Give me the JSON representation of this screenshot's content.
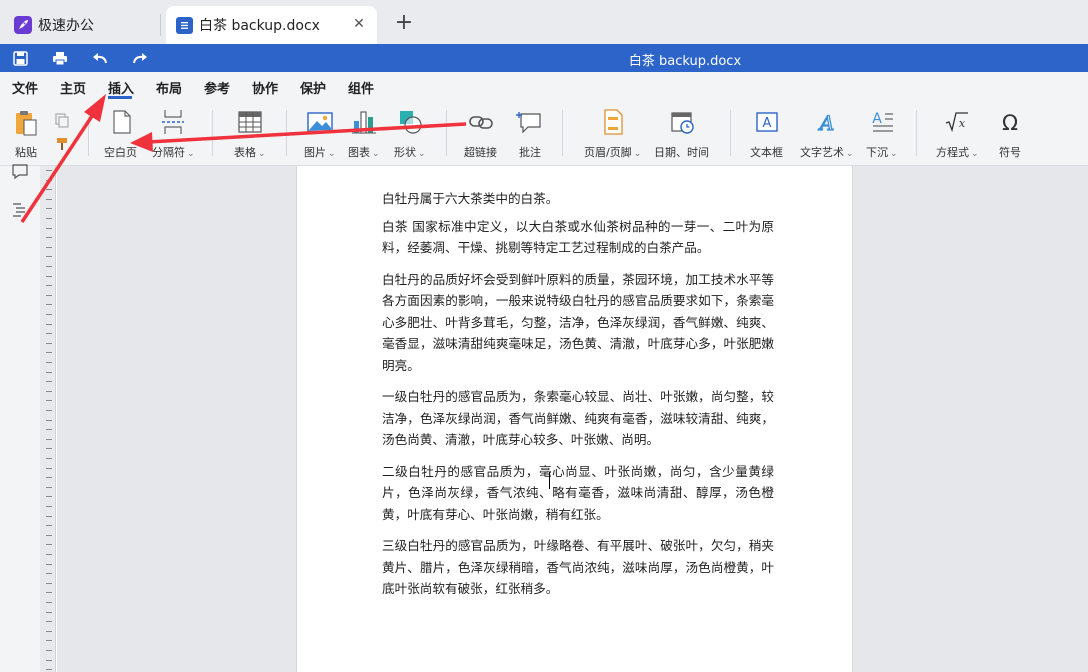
{
  "tabs": {
    "app_label": "极速办公",
    "doc_label": "白茶 backup.docx"
  },
  "title": "白茶 backup.docx",
  "menu": [
    "文件",
    "主页",
    "插入",
    "布局",
    "参考",
    "协作",
    "保护",
    "组件"
  ],
  "ribbon": {
    "paste": "粘贴",
    "blank_page": "空白页",
    "page_break": "分隔符",
    "table": "表格",
    "image": "图片",
    "chart": "图表",
    "shape": "形状",
    "hyperlink": "超链接",
    "comment": "批注",
    "header_footer": "页眉/页脚",
    "date_time": "日期、时间",
    "textbox": "文本框",
    "wordart": "文字艺术",
    "dropcap": "下沉",
    "equation": "方程式",
    "symbol": "符号"
  },
  "document": {
    "paragraphs": [
      "白牡丹属于六大茶类中的白茶。",
      "  白茶 国家标准中定义，以大白茶或水仙茶树品种的一芽一、二叶为原料，经萎凋、干燥、挑剔等特定工艺过程制成的白茶产品。",
      "白牡丹的品质好坏会受到鲜叶原料的质量，茶园环境，加工技术水平等各方面因素的影响，一般来说特级白牡丹的感官品质要求如下，条索毫心多肥壮、叶背多茸毛，匀整，洁净，色泽灰绿润，香气鲜嫩、纯爽、 毫香显，滋味清甜纯爽毫味足，汤色黄、清澈，叶底芽心多，叶张肥嫩明亮。",
      "一级白牡丹的感官品质为，条索毫心较显、尚壮、叶张嫩，尚匀整，较洁净，色泽灰绿尚润，香气尚鲜嫩、纯爽有毫香，滋味较清甜、纯爽，汤色尚黄、清澈，叶底芽心较多、叶张嫩、尚明。",
      "二级白牡丹的感官品质为，毫心尚显、叶张尚嫩，尚匀，含少量黄绿片，色泽尚灰绿，香气浓纯、略有毫香，滋味尚清甜、醇厚，汤色橙黄，叶底有芽心、叶张尚嫩，稍有红张。",
      "三级白牡丹的感官品质为，叶缘略卷、有平展叶、破张叶，欠匀，稍夹黄片、腊片，色泽灰绿稍暗，香气尚浓纯，滋味尚厚，汤色尚橙黄，叶底叶张尚软有破张，红张稍多。"
    ]
  },
  "colors": {
    "accent": "#2d64c9",
    "annotation_arrow": "#f0323c"
  }
}
